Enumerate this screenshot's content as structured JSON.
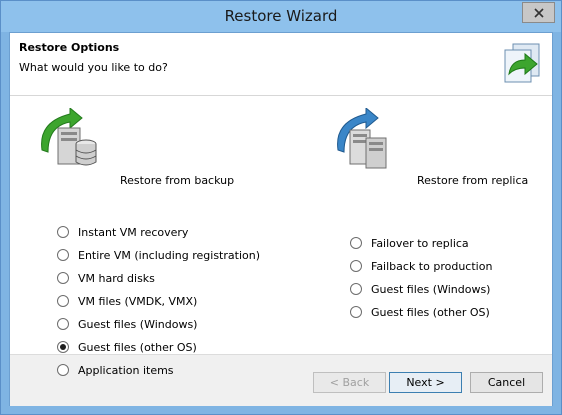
{
  "window": {
    "title": "Restore Wizard"
  },
  "header": {
    "title": "Restore Options",
    "subtitle": "What would you like to do?"
  },
  "backup": {
    "label": "Restore from backup",
    "options": [
      {
        "label": "Instant VM recovery",
        "checked": false
      },
      {
        "label": "Entire VM (including registration)",
        "checked": false
      },
      {
        "label": "VM hard disks",
        "checked": false
      },
      {
        "label": "VM files (VMDK, VMX)",
        "checked": false
      },
      {
        "label": "Guest files (Windows)",
        "checked": false
      },
      {
        "label": "Guest files (other OS)",
        "checked": true
      },
      {
        "label": "Application items",
        "checked": false
      }
    ]
  },
  "replica": {
    "label": "Restore from replica",
    "options": [
      {
        "label": "Failover to replica",
        "checked": false
      },
      {
        "label": "Failback to production",
        "checked": false
      },
      {
        "label": "Guest files (Windows)",
        "checked": false
      },
      {
        "label": "Guest files (other OS)",
        "checked": false
      }
    ]
  },
  "buttons": {
    "back": "< Back",
    "next": "Next >",
    "cancel": "Cancel"
  },
  "colors": {
    "title_bar": "#8ec1ec",
    "arrow_green": "#3da52e",
    "arrow_blue": "#3a86c8"
  }
}
